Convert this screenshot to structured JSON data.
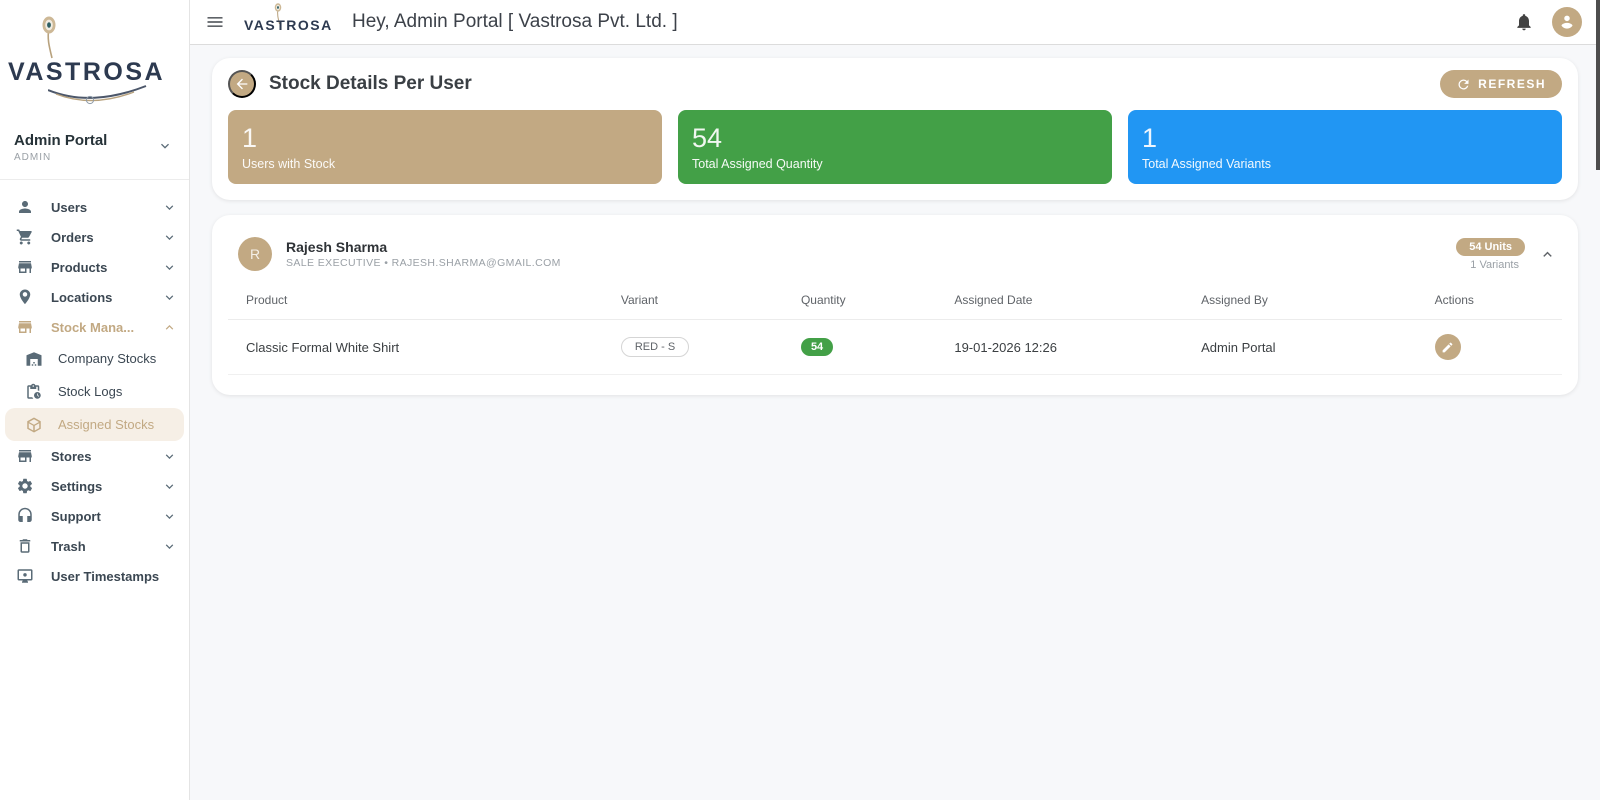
{
  "brand": {
    "name": "VASTROSA",
    "accent": "#c2a983",
    "navy": "#2d3a50"
  },
  "topbar": {
    "title": "Hey, Admin Portal [ Vastrosa Pvt. Ltd. ]",
    "icons": [
      "menu-icon",
      "bell-icon",
      "account-avatar-icon"
    ]
  },
  "sidebar": {
    "profile": {
      "name": "Admin Portal",
      "role": "ADMIN"
    },
    "items": [
      {
        "label": "Users",
        "icon": "person-icon"
      },
      {
        "label": "Orders",
        "icon": "cart-icon"
      },
      {
        "label": "Products",
        "icon": "storefront-icon"
      },
      {
        "label": "Locations",
        "icon": "location-pin-icon"
      },
      {
        "label": "Stock Mana...",
        "icon": "storefront-icon",
        "expanded": true
      },
      {
        "label": "Company Stocks",
        "icon": "warehouse-icon",
        "child": true
      },
      {
        "label": "Stock Logs",
        "icon": "clipboard-clock-icon",
        "child": true
      },
      {
        "label": "Assigned Stocks",
        "icon": "package-box-icon",
        "child": true,
        "active": true
      },
      {
        "label": "Stores",
        "icon": "storefront-icon"
      },
      {
        "label": "Settings",
        "icon": "gear-icon"
      },
      {
        "label": "Support",
        "icon": "headset-icon"
      },
      {
        "label": "Trash",
        "icon": "trash-icon"
      },
      {
        "label": "User Timestamps",
        "icon": "monitor-icon"
      }
    ]
  },
  "page": {
    "title": "Stock Details Per User",
    "refresh_label": "REFRESH",
    "stats": [
      {
        "value": "1",
        "label": "Users with Stock",
        "color": "#c2a983"
      },
      {
        "value": "54",
        "label": "Total Assigned Quantity",
        "color": "#43a047"
      },
      {
        "value": "1",
        "label": "Total Assigned Variants",
        "color": "#2196f3"
      }
    ],
    "user_card": {
      "avatar_initial": "R",
      "name": "Rajesh Sharma",
      "subtitle": "SALE EXECUTIVE • RAJESH.SHARMA@GMAIL.COM",
      "units_badge": "54 Units",
      "variants_text": "1 Variants"
    },
    "table": {
      "columns": [
        "Product",
        "Variant",
        "Quantity",
        "Assigned Date",
        "Assigned By",
        "Actions"
      ],
      "rows": [
        {
          "product": "Classic Formal White Shirt",
          "variant": "RED - S",
          "quantity": "54",
          "assigned_date": "19-01-2026 12:26",
          "assigned_by": "Admin Portal"
        }
      ]
    }
  }
}
